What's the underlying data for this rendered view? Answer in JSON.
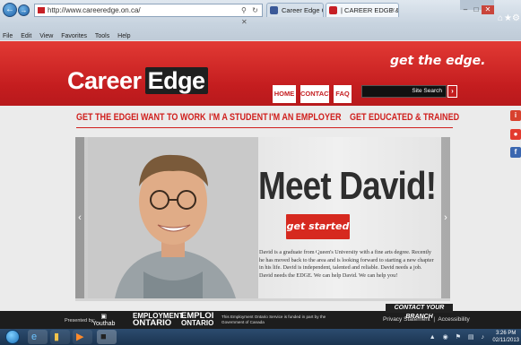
{
  "browser": {
    "address": "http://www.careeredge.on.ca/",
    "tabs": [
      {
        "label": "Career Edge Quinte"
      },
      {
        "label": "| CAREER EDGE & Y..."
      }
    ],
    "menu": [
      "File",
      "Edit",
      "View",
      "Favorites",
      "Tools",
      "Help"
    ],
    "icons": {
      "back": "back-arrow-icon",
      "forward": "forward-arrow-icon",
      "home": "home-icon",
      "favorites": "star-icon",
      "tools": "gear-icon"
    }
  },
  "site": {
    "logo": {
      "part1": "Career",
      "part2": "Edge"
    },
    "tagline": "get the edge.",
    "top_nav": [
      "HOME",
      "CONTACT",
      "FAQ"
    ],
    "search_placeholder": "Site Search",
    "main_nav": [
      "GET THE EDGE",
      "I WANT TO WORK",
      "I'M A STUDENT",
      "I'M AN EMPLOYER",
      "GET EDUCATED & TRAINED"
    ],
    "hero": {
      "headline": "Meet David!",
      "body": "David is a graduate from Queen's University with a fine arts degree. Recently he has moved back to the area and is looking forward to starting a new chapter in his life. David is independent, talented and reliable. David needs a job. David needs the EDGE. We can help David. We can help you!",
      "cta": "get started ›"
    },
    "contact_branch": "CONTACT YOUR BRANCH",
    "footer": {
      "presented_by": "Presented by:",
      "youthab": "Youthab",
      "eo_line1": "EMPLOYMENT",
      "eo_line2": "ONTARIO",
      "eo_fr1": "EMPLOI",
      "eo_fr2": "ONTARIO",
      "eo_note": "This Employment Ontario Service is funded in part by the Government of Canada",
      "privacy": "Privacy Statement",
      "accessibility": "Accessibility"
    },
    "colors": {
      "brand_red": "#c41d1f",
      "dark": "#1d1d1d"
    }
  },
  "taskbar": {
    "time": "3:26 PM",
    "date": "02/11/2013"
  }
}
